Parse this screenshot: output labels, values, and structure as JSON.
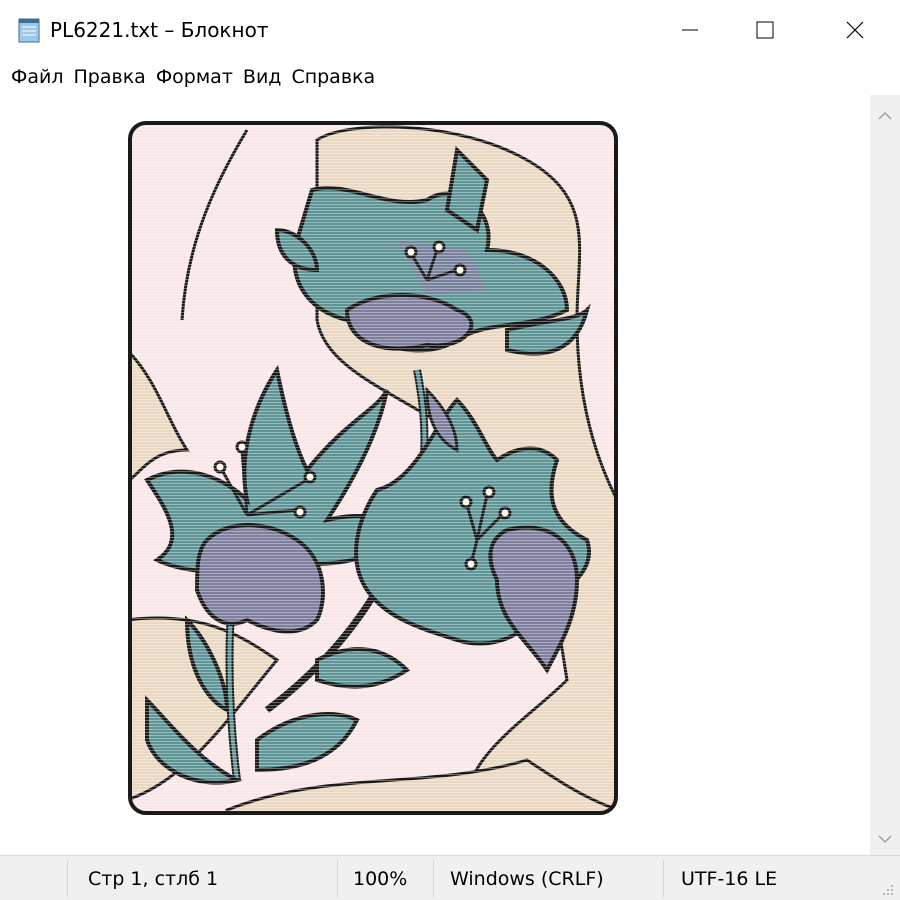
{
  "window": {
    "title": "PL6221.txt – Блокнот",
    "app_icon": "notepad-icon",
    "controls": [
      "minimize-icon",
      "maximize-icon",
      "close-icon"
    ]
  },
  "menu": {
    "items": [
      "Файл",
      "Правка",
      "Формат",
      "Вид",
      "Справка"
    ]
  },
  "editor": {
    "content_description_icon": "ascii-art-flower-image"
  },
  "status": {
    "position": "Стр 1, стлб 1",
    "zoom": "100%",
    "line_ending": "Windows (CRLF)",
    "encoding": "UTF-16 LE"
  },
  "colors": {
    "frame_bg": "#f9e6e6",
    "beige": "#ead8c2",
    "teal": "#5f9596",
    "purple": "#7e7f9e",
    "outline": "#1a1a1a"
  }
}
